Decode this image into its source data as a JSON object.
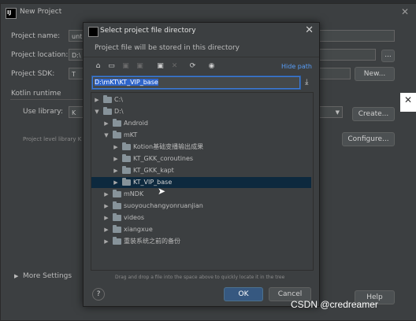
{
  "new_project": {
    "title": "New Project",
    "close": "✕",
    "project_name_label": "Project name:",
    "project_name_value": "unti",
    "project_location_label": "Project location:",
    "project_location_value": "D:\\",
    "browse_label": "...",
    "project_sdk_label": "Project SDK:",
    "project_sdk_value": "T",
    "sdk_new_label": "New...",
    "kotlin_runtime_label": "Kotlin runtime",
    "use_library_label": "Use library:",
    "use_library_value": "K",
    "create_label": "Create...",
    "project_level_label": "Project level library K",
    "configure_label": "Configure...",
    "more_settings_label": "More Settings",
    "help_label": "Help"
  },
  "dialog": {
    "title": "Select project file directory",
    "close": "✕",
    "subtitle": "Project file will be stored in this directory",
    "hide_path_label": "Hide path",
    "path_value": "D:\\mKT\\KT_VIP_base",
    "hint": "Drag and drop a file into the space above to quickly locate it in the tree",
    "help_glyph": "?",
    "ok_label": "OK",
    "cancel_label": "Cancel"
  },
  "tree": [
    {
      "label": "C:\\",
      "expanded": false
    },
    {
      "label": "D:\\",
      "expanded": true
    },
    {
      "label": "Android",
      "expanded": false
    },
    {
      "label": "mKT",
      "expanded": true
    },
    {
      "label": "Kotion基础变播输出成果",
      "expanded": false
    },
    {
      "label": "KT_GKK_coroutines",
      "expanded": false
    },
    {
      "label": "KT_GKK_kapt",
      "expanded": false
    },
    {
      "label": "KT_VIP_base",
      "expanded": false,
      "selected": true
    },
    {
      "label": "mNDK",
      "expanded": false
    },
    {
      "label": "suoyouchangyonruanjian",
      "expanded": false
    },
    {
      "label": "videos",
      "expanded": false
    },
    {
      "label": "xiangxue",
      "expanded": false
    },
    {
      "label": "重装系统之前的备份",
      "expanded": false
    }
  ],
  "watermark": "CSDN @credreamer",
  "icons": {
    "collapsed": "▶",
    "expanded": "▼",
    "home": "⌂",
    "desktop": "▭",
    "new_folder": "▣",
    "delete": "✕",
    "refresh": "⟳",
    "show_hidden": "◉",
    "download": "⤓"
  },
  "colors": {
    "background": "#3c3f41",
    "selection": "#0d293e",
    "ok_button": "#365880",
    "link": "#589df6",
    "path_highlight": "#2f65ca"
  }
}
